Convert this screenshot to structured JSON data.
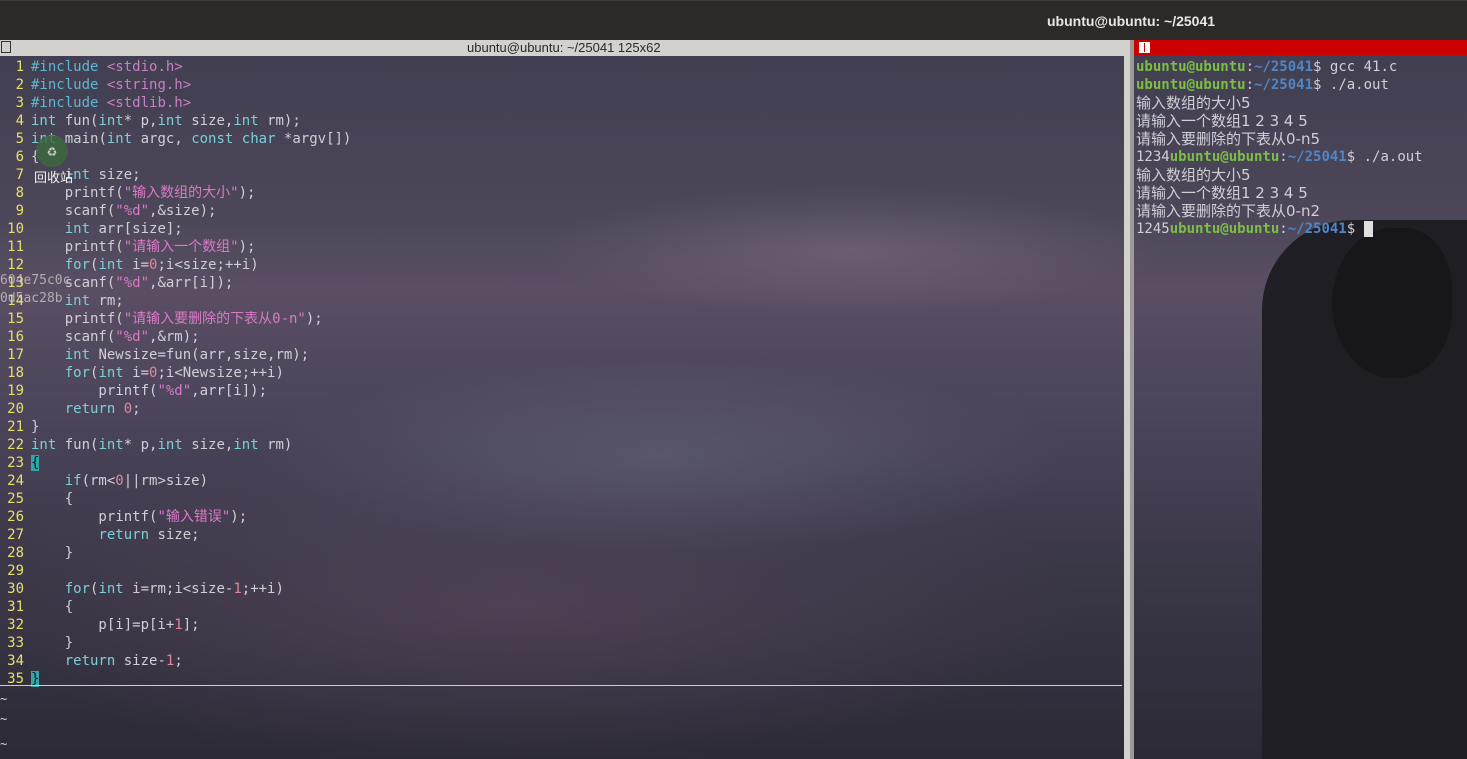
{
  "topbar": {
    "title": "ubuntu@ubuntu: ~/25041"
  },
  "left_pane": {
    "title": "ubuntu@ubuntu: ~/25041 125x62",
    "desktop_icon_label": "回收站",
    "desktop_file_label": [
      "604e75c0c",
      "0d5ac28b"
    ],
    "code_lines": [
      "#include <stdio.h>",
      "#include <string.h>",
      "#include <stdlib.h>",
      "int fun(int* p,int size,int rm);",
      "int main(int argc, const char *argv[])",
      "{",
      "    int size;",
      "    printf(\"输入数组的大小\");",
      "    scanf(\"%d\",&size);",
      "    int arr[size];",
      "    printf(\"请输入一个数组\");",
      "    for(int i=0;i<size;++i)",
      "    scanf(\"%d\",&arr[i]);",
      "    int rm;",
      "    printf(\"请输入要删除的下表从0-n\");",
      "    scanf(\"%d\",&rm);",
      "    int Newsize=fun(arr,size,rm);",
      "    for(int i=0;i<Newsize;++i)",
      "        printf(\"%d\",arr[i]);",
      "    return 0;",
      "}",
      "int fun(int* p,int size,int rm)",
      "{",
      "    if(rm<0||rm>size)",
      "    {",
      "        printf(\"输入错误\");",
      "        return size;",
      "    }",
      "",
      "    for(int i=rm;i<size-1;++i)",
      "    {",
      "        p[i]=p[i+1];",
      "    }",
      "    return size-1;",
      "}"
    ],
    "tilde_marks": [
      "~",
      "~",
      "~"
    ]
  },
  "right_pane": {
    "prompt_user": "ubuntu@ubuntu",
    "prompt_path": "~/25041",
    "prompt_suffix": "$ ",
    "lines": [
      {
        "type": "prompt",
        "prefix": "",
        "cmd": "gcc 41.c"
      },
      {
        "type": "prompt",
        "prefix": "",
        "cmd": "./a.out"
      },
      {
        "type": "text",
        "text": "输入数组的大小5"
      },
      {
        "type": "text",
        "text": "请输入一个数组1 2 3 4 5"
      },
      {
        "type": "text",
        "text": "请输入要删除的下表从0-n5"
      },
      {
        "type": "prompt",
        "prefix": "1234",
        "cmd": "./a.out"
      },
      {
        "type": "text",
        "text": "输入数组的大小5"
      },
      {
        "type": "text",
        "text": "请输入一个数组1 2 3 4 5"
      },
      {
        "type": "text",
        "text": "请输入要删除的下表从0-n2"
      },
      {
        "type": "prompt",
        "prefix": "1245",
        "cmd": "",
        "cursor": true
      }
    ]
  },
  "colors": {
    "line_number": "#e5e06a",
    "prompt_user": "#7bc043",
    "prompt_path": "#4f86c6",
    "active_titlebar": "#cc0000"
  }
}
